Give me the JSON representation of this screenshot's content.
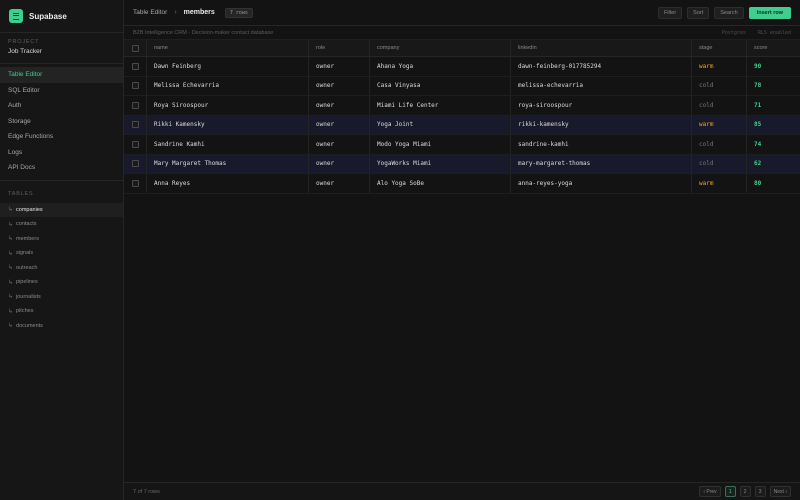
{
  "app": {
    "brand": "Supabase"
  },
  "sidebar": {
    "project_label": "PROJECT",
    "project_name": "Job Tracker",
    "nav": [
      {
        "label": "Table Editor",
        "active": true
      },
      {
        "label": "SQL Editor",
        "active": false
      },
      {
        "label": "Auth",
        "active": false
      },
      {
        "label": "Storage",
        "active": false
      },
      {
        "label": "Edge Functions",
        "active": false
      },
      {
        "label": "Logs",
        "active": false
      },
      {
        "label": "API Docs",
        "active": false
      }
    ],
    "tables_label": "TABLES",
    "tables": [
      {
        "label": "companies",
        "active": true
      },
      {
        "label": "contacts",
        "active": false
      },
      {
        "label": "members",
        "active": false
      },
      {
        "label": "signals",
        "active": false
      },
      {
        "label": "outreach",
        "active": false
      },
      {
        "label": "pipelines",
        "active": false
      },
      {
        "label": "journalists",
        "active": false
      },
      {
        "label": "pitches",
        "active": false
      },
      {
        "label": "documents",
        "active": false
      }
    ]
  },
  "topbar": {
    "crumb_root": "Table Editor",
    "crumb_sep": "›",
    "crumb_current": "members",
    "rows_badge": "7 rows",
    "buttons": {
      "filter": "Filter",
      "sort": "Sort",
      "search": "Search",
      "insert": "Insert row"
    }
  },
  "subbar": {
    "description": "B2B Intelligence CRM · Decision-maker contact database",
    "meta_db": "Postgres",
    "meta_rls": "RLS enabled"
  },
  "grid": {
    "columns": [
      "name",
      "role",
      "company",
      "linkedin",
      "stage",
      "score"
    ],
    "rows": [
      {
        "name": "Dawn Feinberg",
        "role": "owner",
        "company": "Ahana Yoga",
        "linkedin": "dawn-feinberg-017785294",
        "stage": "warm",
        "score": "90"
      },
      {
        "name": "Melissa Echevarria",
        "role": "owner",
        "company": "Casa Vinyasa",
        "linkedin": "melissa-echevarria",
        "stage": "cold",
        "score": "78"
      },
      {
        "name": "Roya Siroospour",
        "role": "owner",
        "company": "Miami Life Center",
        "linkedin": "roya-siroospour",
        "stage": "cold",
        "score": "71"
      },
      {
        "name": "Rikki Kamensky",
        "role": "owner",
        "company": "Yoga Joint",
        "linkedin": "rikki-kamensky",
        "stage": "warm",
        "score": "85"
      },
      {
        "name": "Sandrine Kamhi",
        "role": "owner",
        "company": "Modo Yoga Miami",
        "linkedin": "sandrine-kamhi",
        "stage": "cold",
        "score": "74"
      },
      {
        "name": "Mary Margaret Thomas",
        "role": "owner",
        "company": "YogaWorks Miami",
        "linkedin": "mary-margaret-thomas",
        "stage": "cold",
        "score": "62"
      },
      {
        "name": "Anna Reyes",
        "role": "owner",
        "company": "Alo Yoga SoBe",
        "linkedin": "anna-reyes-yoga",
        "stage": "warm",
        "score": "80"
      }
    ]
  },
  "footer": {
    "count": "7 of 7 rows",
    "prev": "‹ Prev",
    "pages": [
      "1",
      "2",
      "3"
    ],
    "current_page": "1",
    "next": "Next ›"
  },
  "colors": {
    "accent": "#3ecf8e",
    "warm": "#f5a524",
    "cold": "#777777"
  }
}
